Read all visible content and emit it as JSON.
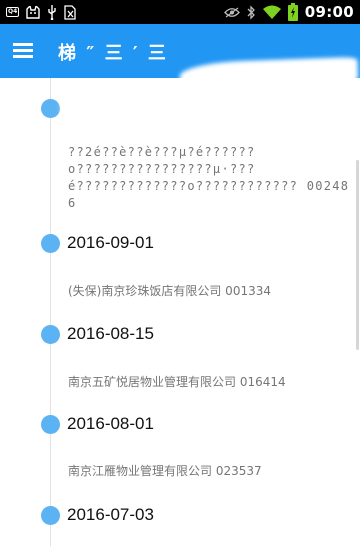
{
  "status_bar": {
    "sim_badge": "Q4",
    "clock": "09:00"
  },
  "app_bar": {
    "title": "梯 ″ 三 ′ 三",
    "menu_icon": "hamburger-menu-icon"
  },
  "timeline": {
    "entries": [
      {
        "date": "",
        "detail": "??2é??è??è???μ?é??????o????????????????μ·???é?????????????o????????????  002486"
      },
      {
        "date": "2016-09-01",
        "detail": "(失保)南京珍珠饭店有限公司  001334"
      },
      {
        "date": "2016-08-15",
        "detail": "南京五矿悦居物业管理有限公司  016414"
      },
      {
        "date": "2016-08-01",
        "detail": "南京江雁物业管理有限公司  023537"
      },
      {
        "date": "2016-07-03",
        "detail": ""
      }
    ]
  },
  "colors": {
    "app_bar": "#2196f3",
    "timeline_dot": "#5cb3f3",
    "status_bar": "#000000"
  }
}
